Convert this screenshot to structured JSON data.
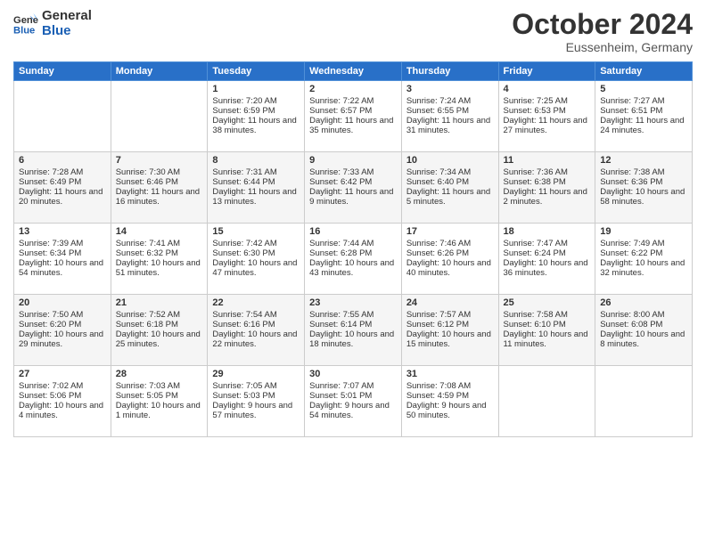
{
  "header": {
    "logo_line1": "General",
    "logo_line2": "Blue",
    "month": "October 2024",
    "location": "Eussenheim, Germany"
  },
  "weekdays": [
    "Sunday",
    "Monday",
    "Tuesday",
    "Wednesday",
    "Thursday",
    "Friday",
    "Saturday"
  ],
  "weeks": [
    [
      {
        "day": "",
        "sunrise": "",
        "sunset": "",
        "daylight": ""
      },
      {
        "day": "",
        "sunrise": "",
        "sunset": "",
        "daylight": ""
      },
      {
        "day": "1",
        "sunrise": "Sunrise: 7:20 AM",
        "sunset": "Sunset: 6:59 PM",
        "daylight": "Daylight: 11 hours and 38 minutes."
      },
      {
        "day": "2",
        "sunrise": "Sunrise: 7:22 AM",
        "sunset": "Sunset: 6:57 PM",
        "daylight": "Daylight: 11 hours and 35 minutes."
      },
      {
        "day": "3",
        "sunrise": "Sunrise: 7:24 AM",
        "sunset": "Sunset: 6:55 PM",
        "daylight": "Daylight: 11 hours and 31 minutes."
      },
      {
        "day": "4",
        "sunrise": "Sunrise: 7:25 AM",
        "sunset": "Sunset: 6:53 PM",
        "daylight": "Daylight: 11 hours and 27 minutes."
      },
      {
        "day": "5",
        "sunrise": "Sunrise: 7:27 AM",
        "sunset": "Sunset: 6:51 PM",
        "daylight": "Daylight: 11 hours and 24 minutes."
      }
    ],
    [
      {
        "day": "6",
        "sunrise": "Sunrise: 7:28 AM",
        "sunset": "Sunset: 6:49 PM",
        "daylight": "Daylight: 11 hours and 20 minutes."
      },
      {
        "day": "7",
        "sunrise": "Sunrise: 7:30 AM",
        "sunset": "Sunset: 6:46 PM",
        "daylight": "Daylight: 11 hours and 16 minutes."
      },
      {
        "day": "8",
        "sunrise": "Sunrise: 7:31 AM",
        "sunset": "Sunset: 6:44 PM",
        "daylight": "Daylight: 11 hours and 13 minutes."
      },
      {
        "day": "9",
        "sunrise": "Sunrise: 7:33 AM",
        "sunset": "Sunset: 6:42 PM",
        "daylight": "Daylight: 11 hours and 9 minutes."
      },
      {
        "day": "10",
        "sunrise": "Sunrise: 7:34 AM",
        "sunset": "Sunset: 6:40 PM",
        "daylight": "Daylight: 11 hours and 5 minutes."
      },
      {
        "day": "11",
        "sunrise": "Sunrise: 7:36 AM",
        "sunset": "Sunset: 6:38 PM",
        "daylight": "Daylight: 11 hours and 2 minutes."
      },
      {
        "day": "12",
        "sunrise": "Sunrise: 7:38 AM",
        "sunset": "Sunset: 6:36 PM",
        "daylight": "Daylight: 10 hours and 58 minutes."
      }
    ],
    [
      {
        "day": "13",
        "sunrise": "Sunrise: 7:39 AM",
        "sunset": "Sunset: 6:34 PM",
        "daylight": "Daylight: 10 hours and 54 minutes."
      },
      {
        "day": "14",
        "sunrise": "Sunrise: 7:41 AM",
        "sunset": "Sunset: 6:32 PM",
        "daylight": "Daylight: 10 hours and 51 minutes."
      },
      {
        "day": "15",
        "sunrise": "Sunrise: 7:42 AM",
        "sunset": "Sunset: 6:30 PM",
        "daylight": "Daylight: 10 hours and 47 minutes."
      },
      {
        "day": "16",
        "sunrise": "Sunrise: 7:44 AM",
        "sunset": "Sunset: 6:28 PM",
        "daylight": "Daylight: 10 hours and 43 minutes."
      },
      {
        "day": "17",
        "sunrise": "Sunrise: 7:46 AM",
        "sunset": "Sunset: 6:26 PM",
        "daylight": "Daylight: 10 hours and 40 minutes."
      },
      {
        "day": "18",
        "sunrise": "Sunrise: 7:47 AM",
        "sunset": "Sunset: 6:24 PM",
        "daylight": "Daylight: 10 hours and 36 minutes."
      },
      {
        "day": "19",
        "sunrise": "Sunrise: 7:49 AM",
        "sunset": "Sunset: 6:22 PM",
        "daylight": "Daylight: 10 hours and 32 minutes."
      }
    ],
    [
      {
        "day": "20",
        "sunrise": "Sunrise: 7:50 AM",
        "sunset": "Sunset: 6:20 PM",
        "daylight": "Daylight: 10 hours and 29 minutes."
      },
      {
        "day": "21",
        "sunrise": "Sunrise: 7:52 AM",
        "sunset": "Sunset: 6:18 PM",
        "daylight": "Daylight: 10 hours and 25 minutes."
      },
      {
        "day": "22",
        "sunrise": "Sunrise: 7:54 AM",
        "sunset": "Sunset: 6:16 PM",
        "daylight": "Daylight: 10 hours and 22 minutes."
      },
      {
        "day": "23",
        "sunrise": "Sunrise: 7:55 AM",
        "sunset": "Sunset: 6:14 PM",
        "daylight": "Daylight: 10 hours and 18 minutes."
      },
      {
        "day": "24",
        "sunrise": "Sunrise: 7:57 AM",
        "sunset": "Sunset: 6:12 PM",
        "daylight": "Daylight: 10 hours and 15 minutes."
      },
      {
        "day": "25",
        "sunrise": "Sunrise: 7:58 AM",
        "sunset": "Sunset: 6:10 PM",
        "daylight": "Daylight: 10 hours and 11 minutes."
      },
      {
        "day": "26",
        "sunrise": "Sunrise: 8:00 AM",
        "sunset": "Sunset: 6:08 PM",
        "daylight": "Daylight: 10 hours and 8 minutes."
      }
    ],
    [
      {
        "day": "27",
        "sunrise": "Sunrise: 7:02 AM",
        "sunset": "Sunset: 5:06 PM",
        "daylight": "Daylight: 10 hours and 4 minutes."
      },
      {
        "day": "28",
        "sunrise": "Sunrise: 7:03 AM",
        "sunset": "Sunset: 5:05 PM",
        "daylight": "Daylight: 10 hours and 1 minute."
      },
      {
        "day": "29",
        "sunrise": "Sunrise: 7:05 AM",
        "sunset": "Sunset: 5:03 PM",
        "daylight": "Daylight: 9 hours and 57 minutes."
      },
      {
        "day": "30",
        "sunrise": "Sunrise: 7:07 AM",
        "sunset": "Sunset: 5:01 PM",
        "daylight": "Daylight: 9 hours and 54 minutes."
      },
      {
        "day": "31",
        "sunrise": "Sunrise: 7:08 AM",
        "sunset": "Sunset: 4:59 PM",
        "daylight": "Daylight: 9 hours and 50 minutes."
      },
      {
        "day": "",
        "sunrise": "",
        "sunset": "",
        "daylight": ""
      },
      {
        "day": "",
        "sunrise": "",
        "sunset": "",
        "daylight": ""
      }
    ]
  ]
}
